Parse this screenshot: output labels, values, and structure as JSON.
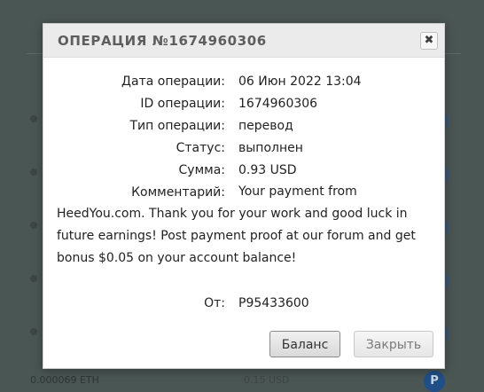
{
  "dialog": {
    "title": "ОПЕРАЦИЯ №1674960306",
    "close_glyph": "✖",
    "fields": [
      {
        "label": "Дата операции:",
        "value": "06 Июн 2022 13:04"
      },
      {
        "label": "ID операции:",
        "value": "1674960306"
      },
      {
        "label": "Тип операции:",
        "value": "перевод"
      },
      {
        "label": "Статус:",
        "value": "выполнен"
      },
      {
        "label": "Сумма:",
        "value": "0.93 USD"
      }
    ],
    "comment_label": "Комментарий:",
    "comment_text": "Your payment from HeedYou.com. Thank you for your work and good luck in future earnings! Post payment proof at our forum and get bonus $0.05 on your account balance!",
    "from_label": "От:",
    "from_value": "P95433600",
    "buttons": {
      "balance": "Баланс",
      "close": "Закрыть"
    }
  },
  "background": {
    "bottom_left_text": "0.000069 ETH",
    "bottom_mid_text": "0.15 USD",
    "p_icon_letter": "P"
  }
}
